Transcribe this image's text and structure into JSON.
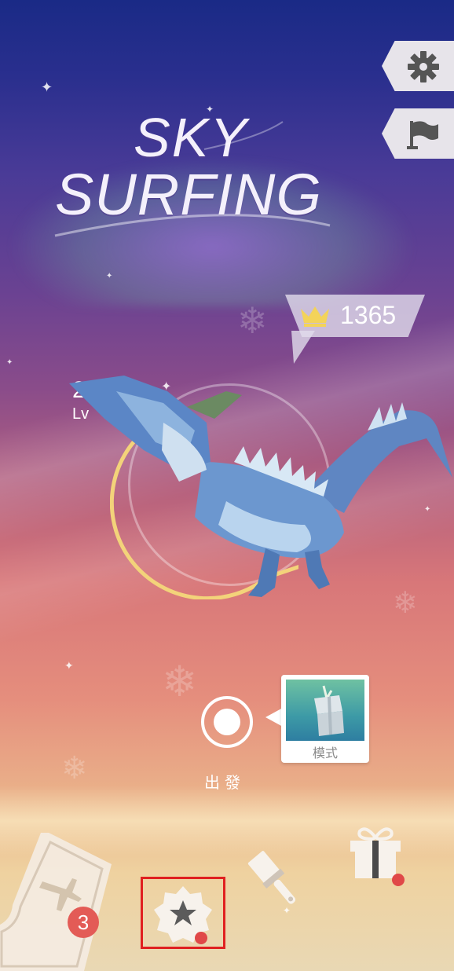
{
  "title": {
    "line1": "SKY",
    "line2": "SURFING"
  },
  "score": {
    "value": "1365",
    "icon": "crown-icon"
  },
  "level": {
    "percent": "2%",
    "label": "Lv"
  },
  "start": {
    "label": "出發"
  },
  "mode": {
    "label": "模式"
  },
  "side_buttons": [
    {
      "icon": "gear-icon"
    },
    {
      "icon": "flag-icon"
    }
  ],
  "bottom_bar": {
    "ticket_badge": "3",
    "icons": [
      "airplane-ticket-icon",
      "star-badge-icon",
      "paint-brush-icon",
      "gift-icon"
    ]
  },
  "colors": {
    "sky_top": "#1a2a86",
    "sky_mid": "#d87779",
    "sand": "#e9d8b4",
    "badge": "#e35b56",
    "highlight": "#e02020",
    "progress_ring": "#f3d37a"
  }
}
